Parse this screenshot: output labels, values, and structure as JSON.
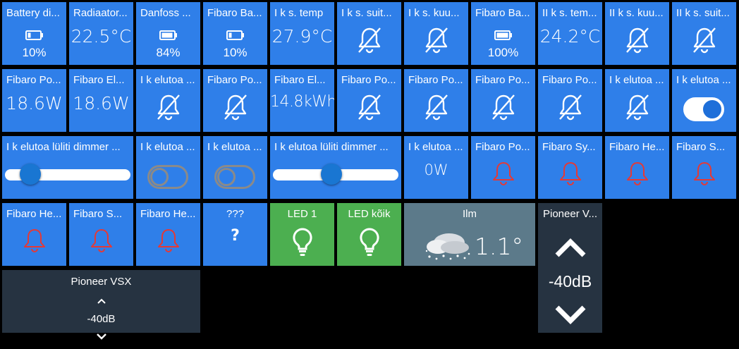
{
  "colors": {
    "tile_blue": "#2f7fe9",
    "tile_green": "#4caf50",
    "tile_gray": "#5c7a8a",
    "tile_dark": "#263341",
    "bell_red": "#e53935",
    "background": "#000000"
  },
  "row1": [
    {
      "title": "Battery di...",
      "percent": "10%",
      "icon": "battery-low-icon"
    },
    {
      "title": "Radiaator...",
      "value": "22.5°C"
    },
    {
      "title": "Danfoss ...",
      "percent": "84%",
      "icon": "battery-high-icon"
    },
    {
      "title": "Fibaro Ba...",
      "percent": "10%",
      "icon": "battery-low-icon"
    },
    {
      "title": "I k s. temp",
      "value": "27.9°C"
    },
    {
      "title": "I k s. suit...",
      "icon": "bell-off-icon"
    },
    {
      "title": "I k s. kuu...",
      "icon": "bell-off-icon"
    },
    {
      "title": "Fibaro Ba...",
      "percent": "100%",
      "icon": "battery-full-icon"
    },
    {
      "title": "II k s. tem...",
      "value": "24.2°C"
    },
    {
      "title": "II k s. kuu...",
      "icon": "bell-off-icon"
    },
    {
      "title": "II k s. suit...",
      "icon": "bell-off-icon"
    }
  ],
  "row2": [
    {
      "title": "Fibaro Po...",
      "value": "18.6W"
    },
    {
      "title": "Fibaro El...",
      "value": "18.6W"
    },
    {
      "title": "I k elutoa ...",
      "icon": "bell-off-icon"
    },
    {
      "title": "Fibaro Po...",
      "icon": "bell-off-icon"
    },
    {
      "title": "Fibaro El...",
      "value": "14.8kWh"
    },
    {
      "title": "Fibaro Po...",
      "icon": "bell-off-icon"
    },
    {
      "title": "Fibaro Po...",
      "icon": "bell-off-icon"
    },
    {
      "title": "Fibaro Po...",
      "icon": "bell-off-icon"
    },
    {
      "title": "Fibaro Po...",
      "icon": "bell-off-icon"
    },
    {
      "title": "I k elutoa ...",
      "icon": "bell-off-icon"
    },
    {
      "title": "I k elutoa ...",
      "toggle": "on"
    }
  ],
  "row3": {
    "dimmer1": {
      "title": "I k elutoa lüliti dimmer ...",
      "level_fraction": 0.14
    },
    "toggle1": {
      "title": "I k elutoa ...",
      "toggle": "off"
    },
    "toggle2": {
      "title": "I k elutoa ...",
      "toggle": "off"
    },
    "dimmer2": {
      "title": "I k elutoa lüliti dimmer ...",
      "level_fraction": 0.46
    },
    "power": {
      "title": "I k elutoa ...",
      "value": "0W"
    },
    "alarms": [
      {
        "title": "Fibaro Po...",
        "icon": "bell-alert-icon"
      },
      {
        "title": "Fibaro Sy...",
        "icon": "bell-alert-icon"
      },
      {
        "title": "Fibaro He...",
        "icon": "bell-alert-icon"
      },
      {
        "title": "Fibaro S...",
        "icon": "bell-alert-icon"
      }
    ]
  },
  "row4": {
    "alarms": [
      {
        "title": "Fibaro He...",
        "icon": "bell-alert-icon"
      },
      {
        "title": "Fibaro S...",
        "icon": "bell-alert-icon"
      },
      {
        "title": "Fibaro He...",
        "icon": "bell-alert-icon"
      }
    ],
    "unknown": {
      "title": "???",
      "glyph": "?"
    },
    "led1": {
      "title": "LED 1",
      "icon": "lightbulb-icon"
    },
    "led_all": {
      "title": "LED kõik",
      "icon": "lightbulb-icon"
    },
    "weather": {
      "title": "Ilm",
      "value": "1.1°",
      "icon": "snow-cloud-icon"
    }
  },
  "pioneer_small": {
    "title": "Pioneer VSX",
    "value": "-40dB"
  },
  "pioneer_tall": {
    "title": "Pioneer V...",
    "value": "-40dB"
  }
}
